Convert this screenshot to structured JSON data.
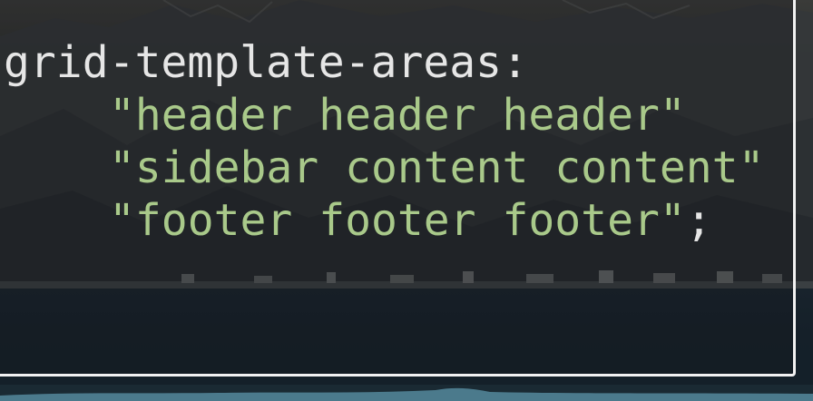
{
  "code": {
    "property": "grid-template-areas",
    "colon": ":",
    "lines": [
      "\"header header header\"",
      "\"sidebar content content\"",
      "\"footer footer footer\""
    ],
    "terminator": ";"
  },
  "colors": {
    "property_text": "#e6e6e6",
    "string_text": "#a9c98a",
    "panel_border": "#f2f2f2",
    "water": "#152029",
    "bottom_strip": "#4b7a8c"
  }
}
